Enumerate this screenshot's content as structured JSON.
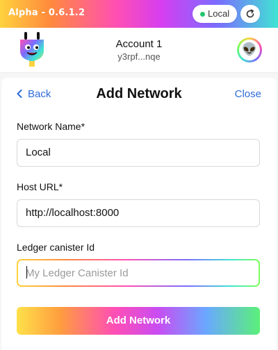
{
  "topbar": {
    "version": "Alpha - 0.6.1.2",
    "network": {
      "label": "Local",
      "status_color": "#25c46f"
    },
    "refresh_icon": "refresh-icon"
  },
  "account": {
    "name": "Account 1",
    "address": "y3rpf...nqe",
    "avatar_emoji": "👽"
  },
  "page": {
    "back_label": "Back",
    "title": "Add Network",
    "close_label": "Close"
  },
  "form": {
    "network_name": {
      "label": "Network Name*",
      "value": "Local"
    },
    "host_url": {
      "label": "Host URL*",
      "value": "http://localhost:8000"
    },
    "ledger_canister": {
      "label": "Ledger canister Id",
      "value": "",
      "placeholder": "My Ledger Canister Id"
    },
    "submit_label": "Add Network"
  },
  "colors": {
    "link": "#2e6bd8",
    "status_green": "#25c46f"
  }
}
